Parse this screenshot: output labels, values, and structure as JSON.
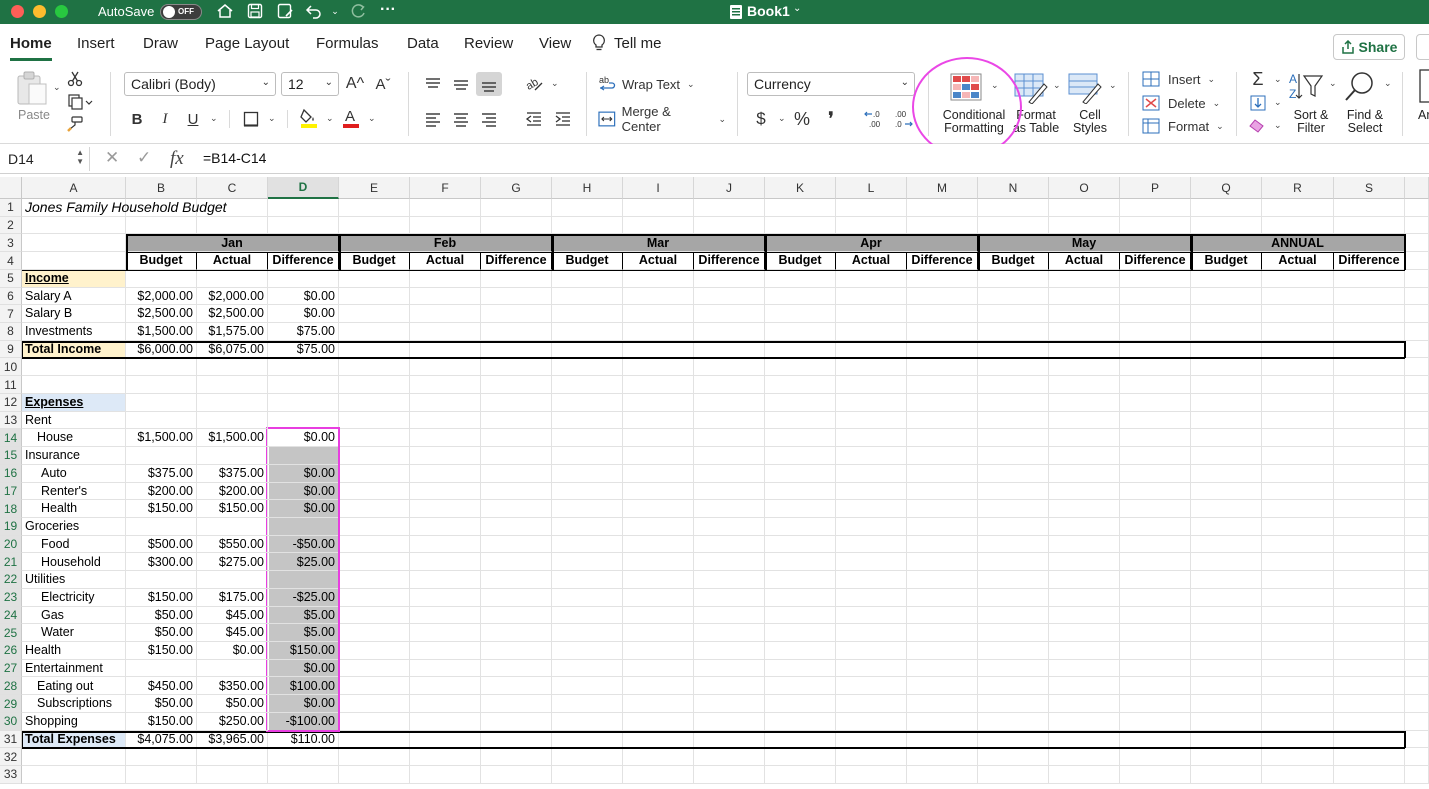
{
  "titlebar": {
    "autosave_label": "AutoSave",
    "toggle_state": "OFF",
    "doc_title": "Book1",
    "more": "···"
  },
  "tabs": [
    "Home",
    "Insert",
    "Draw",
    "Page Layout",
    "Formulas",
    "Data",
    "Review",
    "View",
    "Tell me"
  ],
  "share_label": "Share",
  "ribbon": {
    "paste": "Paste",
    "font_name": "Calibri (Body)",
    "font_size": "12",
    "grow_font": "A^",
    "shrink_font": "Aˇ",
    "bold": "B",
    "italic": "I",
    "underline": "U",
    "wrap_text": "Wrap Text",
    "merge_center": "Merge & Center",
    "number_format": "Currency",
    "currency_symbol": "$",
    "percent_symbol": "%",
    "comma_symbol": "❜",
    "increase_decimal": "←.0\n.00",
    "decrease_decimal": ".00\n→.0",
    "conditional_formatting": "Conditional\nFormatting",
    "format_as_table": "Format\nas Table",
    "cell_styles": "Cell\nStyles",
    "insert": "Insert",
    "delete": "Delete",
    "format": "Format",
    "sort_filter": "Sort &\nFilter",
    "find_select": "Find &\nSelect",
    "more_label": "Ar"
  },
  "formula_bar": {
    "name_box": "D14",
    "cancel": "✕",
    "confirm": "✓",
    "fx": "fx",
    "formula": "=B14-C14"
  },
  "columns": [
    "A",
    "B",
    "C",
    "D",
    "E",
    "F",
    "G",
    "H",
    "I",
    "J",
    "K",
    "L",
    "M",
    "N",
    "O",
    "P",
    "Q",
    "R",
    "S"
  ],
  "selected_column": "D",
  "rows": [
    "1",
    "2",
    "3",
    "4",
    "5",
    "6",
    "7",
    "8",
    "9",
    "10",
    "11",
    "12",
    "13",
    "14",
    "15",
    "16",
    "17",
    "18",
    "19",
    "20",
    "21",
    "22",
    "23",
    "24",
    "25",
    "26",
    "27",
    "28",
    "29",
    "30",
    "31",
    "32",
    "33"
  ],
  "selected_rows": [
    "14",
    "15",
    "16",
    "17",
    "18",
    "19",
    "20",
    "21",
    "22",
    "23",
    "24",
    "25",
    "26",
    "27",
    "28",
    "29",
    "30"
  ],
  "sheet": {
    "title": "Jones Family Household Budget",
    "months": [
      "Jan",
      "Feb",
      "Mar",
      "Apr",
      "May",
      "ANNUAL"
    ],
    "subheaders": [
      "Budget",
      "Actual",
      "Difference"
    ],
    "income_label": "Income",
    "income_rows": [
      {
        "label": "Salary A",
        "budget": "$2,000.00",
        "actual": "$2,000.00",
        "diff": "$0.00"
      },
      {
        "label": "Salary B",
        "budget": "$2,500.00",
        "actual": "$2,500.00",
        "diff": "$0.00"
      },
      {
        "label": "Investments",
        "budget": "$1,500.00",
        "actual": "$1,575.00",
        "diff": "$75.00"
      }
    ],
    "total_income": {
      "label": "Total Income",
      "budget": "$6,000.00",
      "actual": "$6,075.00",
      "diff": "$75.00"
    },
    "expenses_label": "Expenses",
    "expense_rows": [
      {
        "label": "Rent",
        "budget": "",
        "actual": "",
        "diff": ""
      },
      {
        "label": "House",
        "budget": "$1,500.00",
        "actual": "$1,500.00",
        "diff": "$0.00"
      },
      {
        "label": "Insurance",
        "budget": "",
        "actual": "",
        "diff": ""
      },
      {
        "label": "Auto",
        "budget": "$375.00",
        "actual": "$375.00",
        "diff": "$0.00"
      },
      {
        "label": "Renter's",
        "budget": "$200.00",
        "actual": "$200.00",
        "diff": "$0.00"
      },
      {
        "label": "Health",
        "budget": "$150.00",
        "actual": "$150.00",
        "diff": "$0.00"
      },
      {
        "label": "Groceries",
        "budget": "",
        "actual": "",
        "diff": ""
      },
      {
        "label": "Food",
        "budget": "$500.00",
        "actual": "$550.00",
        "diff": "-$50.00"
      },
      {
        "label": "Household",
        "budget": "$300.00",
        "actual": "$275.00",
        "diff": "$25.00"
      },
      {
        "label": "Utilities",
        "budget": "",
        "actual": "",
        "diff": ""
      },
      {
        "label": "Electricity",
        "budget": "$150.00",
        "actual": "$175.00",
        "diff": "-$25.00"
      },
      {
        "label": "Gas",
        "budget": "$50.00",
        "actual": "$45.00",
        "diff": "$5.00"
      },
      {
        "label": "Water",
        "budget": "$50.00",
        "actual": "$45.00",
        "diff": "$5.00"
      },
      {
        "label": "Health",
        "budget": "$150.00",
        "actual": "$0.00",
        "diff": "$150.00"
      },
      {
        "label": "Entertainment",
        "budget": "",
        "actual": "",
        "diff": "$0.00"
      },
      {
        "label": "Eating out",
        "budget": "$450.00",
        "actual": "$350.00",
        "diff": "$100.00"
      },
      {
        "label": "Subscriptions",
        "budget": "$50.00",
        "actual": "$50.00",
        "diff": "$0.00"
      },
      {
        "label": "Shopping",
        "budget": "$150.00",
        "actual": "$250.00",
        "diff": "-$100.00"
      }
    ],
    "total_expenses": {
      "label": "Total Expenses",
      "budget": "$4,075.00",
      "actual": "$3,965.00",
      "diff": "$110.00"
    }
  },
  "colors": {
    "excel_green": "#1f7244",
    "income_fill": "#fff2cc",
    "expenses_fill": "#dde9f7",
    "month_header_fill": "#a6a6a6",
    "selection_fill": "#c5c5c5",
    "annotation_pink": "#e83ee0"
  }
}
